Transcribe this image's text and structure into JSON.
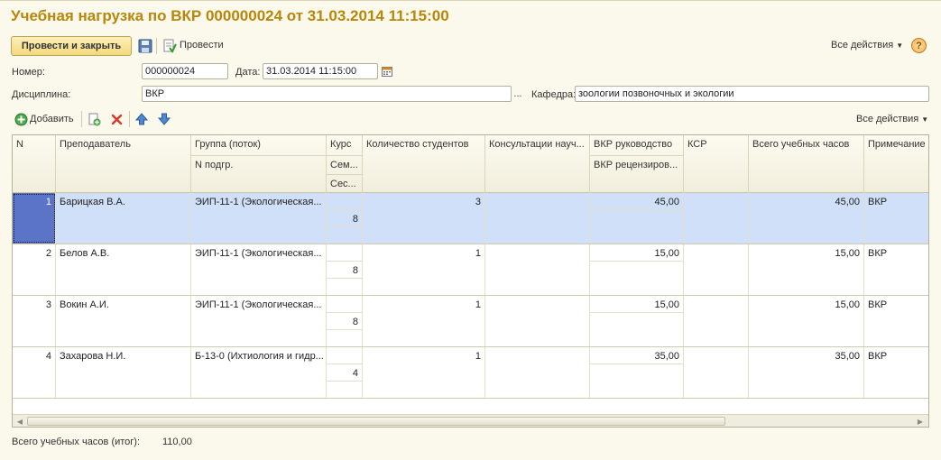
{
  "window": {
    "title": "Учебная нагрузка по ВКР 000000024 от 31.03.2014 11:15:00"
  },
  "toolbar": {
    "post_close_label": "Провести и закрыть",
    "post_label": "Провести",
    "all_actions_label": "Все действия",
    "help_label": "?"
  },
  "form": {
    "number_label": "Номер:",
    "number_value": "000000024",
    "date_label": "Дата:",
    "date_value": "31.03.2014 11:15:00",
    "discipline_label": "Дисциплина:",
    "discipline_value": "ВКР",
    "department_label": "Кафедра:",
    "department_value": "зоологии позвоночных и экологии"
  },
  "table_toolbar": {
    "add_label": "Добавить",
    "all_actions_label": "Все действия"
  },
  "table": {
    "headers": {
      "n": "N",
      "teacher": "Преподаватель",
      "group": "Группа (поток)",
      "subgroup": "N подгр.",
      "course": "Курс",
      "semester": "Сем...",
      "session": "Сес...",
      "students": "Количество студентов",
      "consult": "Консультации науч...",
      "vkr_lead": "ВКР руководство",
      "vkr_review": "ВКР рецензиров...",
      "ksr": "КСР",
      "total": "Всего учебных часов",
      "note": "Примечание"
    },
    "rows": [
      {
        "n": "1",
        "teacher": "Барицкая В.А.",
        "group": "ЭИП-11-1 (Экологическая...",
        "semester": "8",
        "students": "3",
        "vkr_lead": "45,00",
        "total": "45,00",
        "note": "ВКР"
      },
      {
        "n": "2",
        "teacher": "Белов А.В.",
        "group": "ЭИП-11-1 (Экологическая...",
        "semester": "8",
        "students": "1",
        "vkr_lead": "15,00",
        "total": "15,00",
        "note": "ВКР"
      },
      {
        "n": "3",
        "teacher": "Вокин А.И.",
        "group": "ЭИП-11-1 (Экологическая...",
        "semester": "8",
        "students": "1",
        "vkr_lead": "15,00",
        "total": "15,00",
        "note": "ВКР"
      },
      {
        "n": "4",
        "teacher": "Захарова Н.И.",
        "group": "Б-13-0 (Ихтиология и гидр...",
        "semester": "4",
        "students": "1",
        "vkr_lead": "35,00",
        "total": "35,00",
        "note": "ВКР"
      }
    ],
    "selected_row_index": 0
  },
  "footer": {
    "total_label": "Всего учебных часов (итог):",
    "total_value": "110,00"
  },
  "colors": {
    "title": "#b8860b",
    "selected_row": "#cfe0f8",
    "selected_cell": "#5c74c8",
    "background": "#fbf9ec"
  }
}
